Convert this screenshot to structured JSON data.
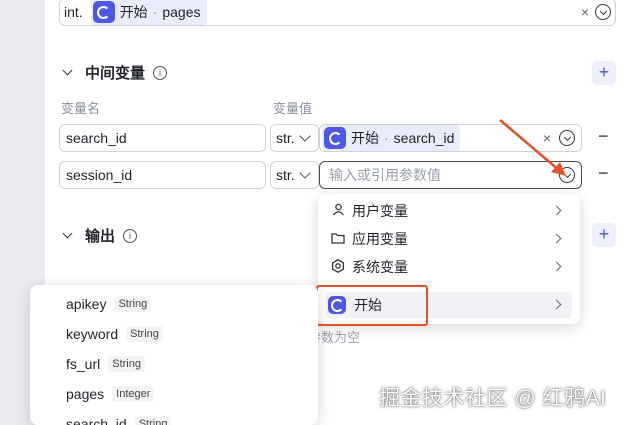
{
  "top_row": {
    "type": "int.",
    "chip_source": "开始",
    "chip_field": "pages"
  },
  "intermediate_vars": {
    "title": "中间变量",
    "col_name": "变量名",
    "col_value": "变量值",
    "rows": [
      {
        "name": "search_id",
        "type": "str.",
        "chip_source": "开始",
        "chip_field": "search_id"
      },
      {
        "name": "session_id",
        "type": "str.",
        "placeholder": "输入或引用参数值"
      }
    ]
  },
  "output": {
    "title": "输出",
    "behind_text": "参数为空"
  },
  "menu": {
    "items": [
      {
        "icon": "user-icon",
        "label": "用户变量"
      },
      {
        "icon": "folder-icon",
        "label": "应用变量"
      },
      {
        "icon": "gear-icon",
        "label": "系统变量"
      },
      {
        "icon": "start-icon",
        "label": "开始"
      }
    ]
  },
  "start_fields": [
    {
      "name": "apikey",
      "type": "String"
    },
    {
      "name": "keyword",
      "type": "String"
    },
    {
      "name": "fs_url",
      "type": "String"
    },
    {
      "name": "pages",
      "type": "Integer"
    },
    {
      "name": "search_id",
      "type": "String"
    }
  ],
  "watermark": "掘金技术社区 @ 红鸦AI",
  "colors": {
    "accent": "#4f57e8",
    "highlight": "#e0522e"
  }
}
